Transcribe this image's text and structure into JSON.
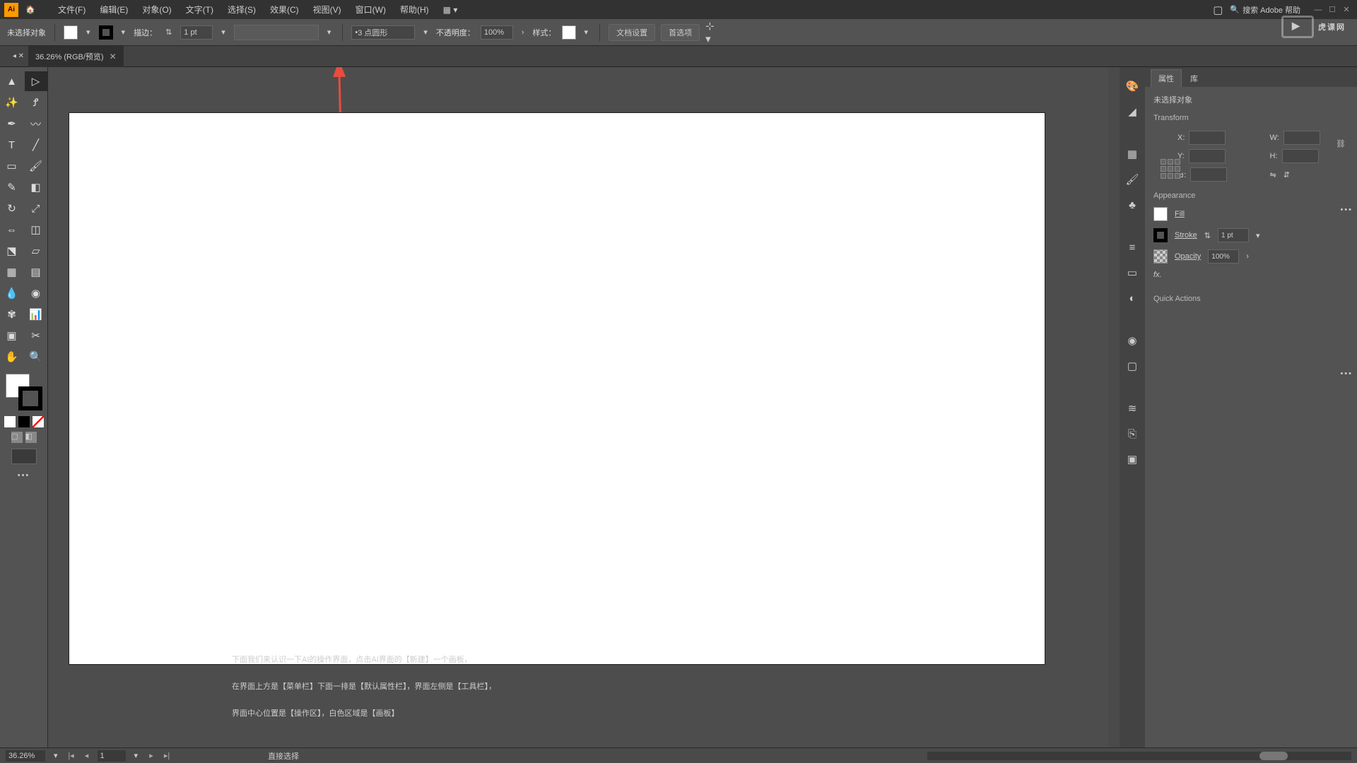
{
  "menu": {
    "file": "文件(F)",
    "edit": "编辑(E)",
    "object": "对象(O)",
    "type": "文字(T)",
    "select": "选择(S)",
    "effect": "效果(C)",
    "view": "视图(V)",
    "window": "窗口(W)",
    "help": "帮助(H)"
  },
  "search": {
    "placeholder": "搜索 Adobe 帮助"
  },
  "propbar": {
    "noSelection": "未选择对象",
    "strokeLabel": "描边：",
    "strokeValue": "1 pt",
    "brushLabel": "3 点圆形",
    "opacityLabel": "不透明度：",
    "opacityValue": "100%",
    "styleLabel": "样式：",
    "docSetup": "文档设置",
    "prefs": "首选项"
  },
  "tab": {
    "title": "36.26% (RGB/预览)"
  },
  "status": {
    "zoom": "36.26%",
    "artboard": "1",
    "tool": "直接选择"
  },
  "panels": {
    "tabProperties": "属性",
    "tabLibraries": "库",
    "noSelection": "未选择对象",
    "transform": "Transform",
    "x": "X:",
    "y": "Y:",
    "w": "W:",
    "h": "H:",
    "appearance": "Appearance",
    "fill": "Fill",
    "stroke": "Stroke",
    "strokeVal": "1 pt",
    "opacity": "Opacity",
    "opacityVal": "100%",
    "fx": "fx.",
    "quickActions": "Quick Actions"
  },
  "annotation": {
    "line1": "下面我们来认识一下AI的操作界面，点击AI界面的【新建】一个画板，",
    "line2": "在界面上方是【菜单栏】下面一排是【默认属性栏】，界面左侧是【工具栏】，",
    "line3": "界面中心位置是【操作区】，白色区域是【画板】"
  },
  "watermark": "虎课网"
}
